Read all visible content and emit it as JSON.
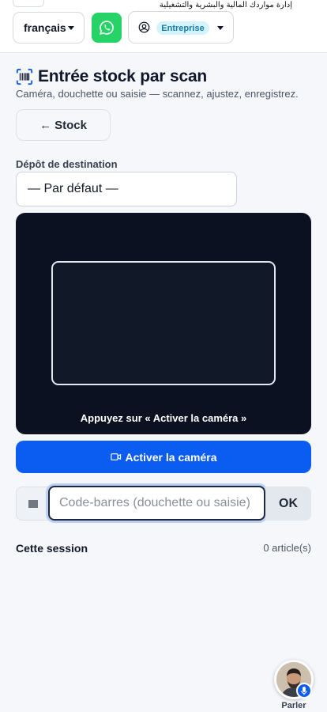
{
  "topbar": {
    "tagline": "إدارة مواردك المالية والبشرية والتشغيلية",
    "language_selected": "français",
    "whatsapp_icon": "whatsapp-icon",
    "account_icon": "user-circle-icon",
    "plan_badge": "Entreprise",
    "whatsapp_color": "#25d366"
  },
  "header": {
    "title": "Entrée stock par scan",
    "title_icon": "barcode-scan-icon",
    "subtitle": "Caméra, douchette ou saisie — scannez, ajustez, enregistrez.",
    "back_arrow": "←",
    "back_label": "Stock"
  },
  "depot": {
    "label": "Dépôt de destination",
    "selected": "— Par défaut —"
  },
  "camera": {
    "hint": "Appuyez sur « Activer la caméra »",
    "activate_label": "Activer la caméra",
    "activate_icon": "video-camera-icon",
    "accent_color": "#0b5cf0"
  },
  "barcode": {
    "prefix_icon": "barcode-icon",
    "value": "",
    "placeholder": "Code-barres (douchette ou saisie)",
    "ok_label": "OK"
  },
  "session": {
    "title": "Cette session",
    "count": "0 article(s)"
  },
  "assistant": {
    "label": "Parler",
    "mic_icon": "microphone-icon"
  }
}
